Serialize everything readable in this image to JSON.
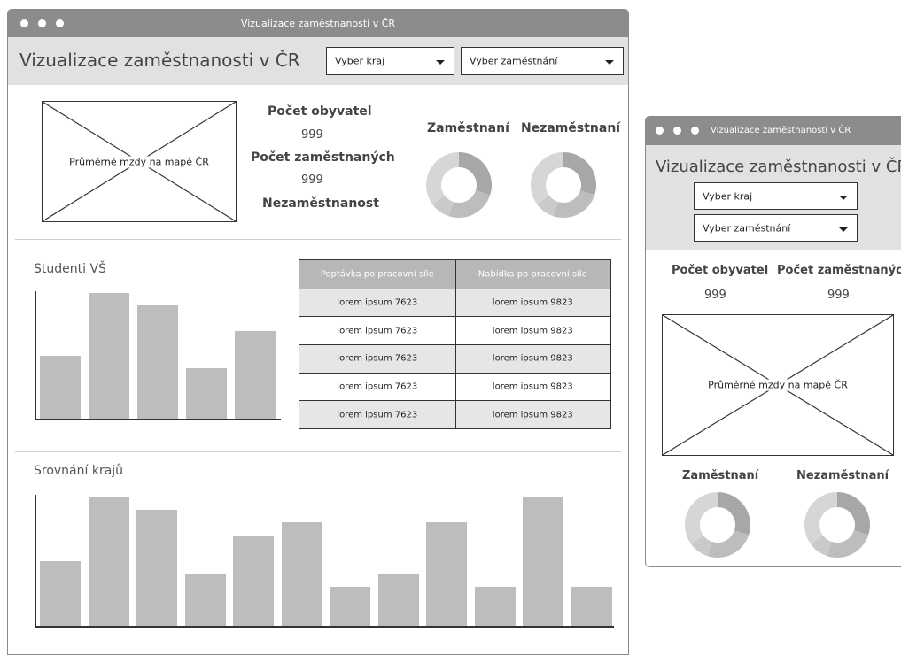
{
  "desktop": {
    "window_title": "Vizualizace zaměstnanosti v ČR",
    "app_title": "Vizualizace zaměstnanosti v ČR",
    "select_region": "Vyber kraj",
    "select_occupation": "Vyber zaměstnání",
    "map_label": "Průměrné mzdy na mapě ČR",
    "stats": {
      "population_label": "Počet obyvatel",
      "population_value": "999",
      "employed_label": "Počet zaměstnaných",
      "employed_value": "999",
      "unemployment_label": "Nezaměstnanost"
    },
    "donut_employed_label": "Zaměstnaní",
    "donut_unemployed_label": "Nezaměstnaní",
    "students_title": "Studenti VŠ",
    "regions_title": "Srovnání krajů",
    "table": {
      "headers": [
        "Poptávka po pracovní síle",
        "Nabídka po pracovní síle"
      ],
      "rows": [
        [
          "lorem ipsum 7623",
          "lorem ipsum 9823"
        ],
        [
          "lorem ipsum 7623",
          "lorem ipsum 9823"
        ],
        [
          "lorem ipsum 7623",
          "lorem ipsum 9823"
        ],
        [
          "lorem ipsum 7623",
          "lorem ipsum 9823"
        ],
        [
          "lorem ipsum 7623",
          "lorem ipsum 9823"
        ]
      ]
    }
  },
  "mobile": {
    "window_title": "Vizualizace zaměstnanosti v ČR",
    "app_title": "Vizualizace zaměstnanosti v ČR",
    "select_region": "Vyber kraj",
    "select_occupation": "Vyber zaměstnání",
    "population_label": "Počet obyvatel",
    "population_value": "999",
    "employed_label": "Počet zaměstnaných",
    "employed_value": "999",
    "map_label": "Průměrné mzdy na mapě ČR",
    "donut_employed_label": "Zaměstnaní",
    "donut_unemployed_label": "Nezaměstnaní"
  },
  "colors": {
    "titlebar": "#8c8c8c",
    "header_bg": "#e1e1e1",
    "bar_fill": "#bdbdbd",
    "table_header": "#b7b7b7",
    "table_stripe": "#e6e6e6",
    "donut_dark": "#a6a6a6",
    "donut_mid": "#bfbfbf",
    "donut_light": "#d9d9d9"
  },
  "chart_data": [
    {
      "type": "bar",
      "name": "students",
      "values": [
        5,
        10,
        9,
        4,
        7
      ],
      "ylim": [
        0,
        10
      ]
    },
    {
      "type": "bar",
      "name": "regions",
      "values": [
        5,
        10,
        9,
        4,
        7,
        8,
        3,
        4,
        8,
        3,
        10,
        3
      ],
      "ylim": [
        0,
        10
      ]
    },
    {
      "type": "pie",
      "name": "donut-desktop-employed",
      "values": [
        30,
        25,
        10,
        35
      ]
    },
    {
      "type": "pie",
      "name": "donut-desktop-unemployed",
      "values": [
        30,
        25,
        10,
        35
      ]
    },
    {
      "type": "pie",
      "name": "donut-mobile-employed",
      "values": [
        30,
        25,
        10,
        35
      ]
    },
    {
      "type": "pie",
      "name": "donut-mobile-unemployed",
      "values": [
        30,
        25,
        10,
        35
      ]
    }
  ]
}
